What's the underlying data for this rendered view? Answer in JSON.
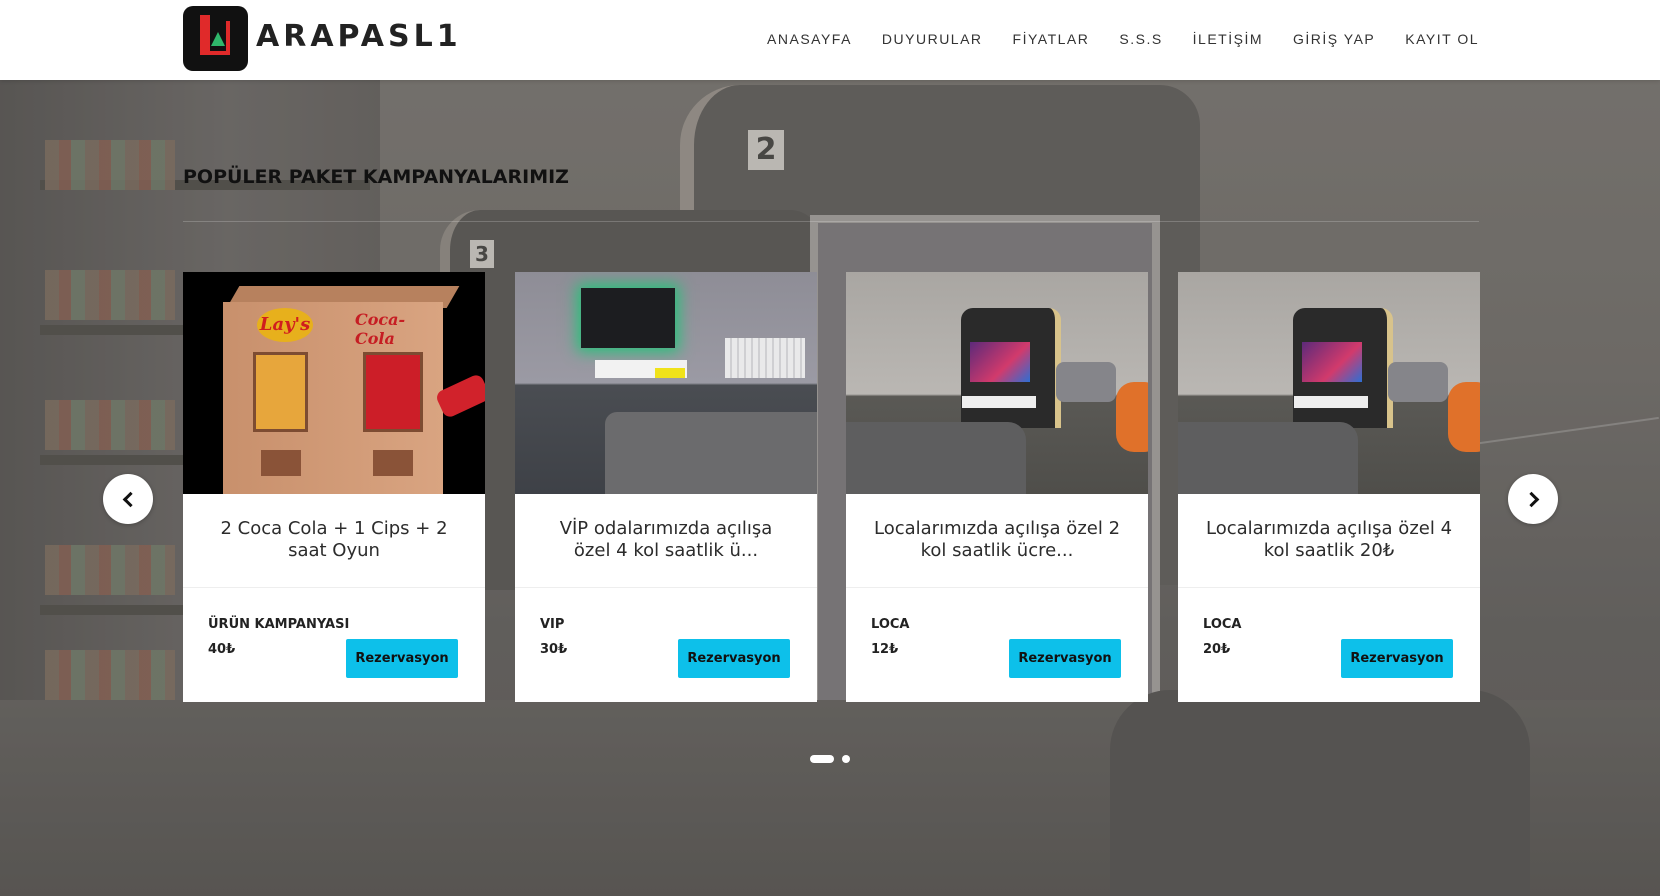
{
  "brand": {
    "name": "ARAPASL1"
  },
  "nav": {
    "items": [
      {
        "label": "ANASAYFA"
      },
      {
        "label": "DUYURULAR"
      },
      {
        "label": "FİYATLAR"
      },
      {
        "label": "S.S.S"
      },
      {
        "label": "İLETİŞİM"
      },
      {
        "label": "GİRİŞ YAP"
      },
      {
        "label": "KAYIT OL"
      }
    ]
  },
  "section": {
    "title": "POPÜLER PAKET KAMPANYALARIMIZ"
  },
  "cards": [
    {
      "title": "2 Coca Cola + 1 Cips + 2 saat Oyun",
      "category": "ÜRÜN KAMPANYASI",
      "price": "40₺",
      "button": "Rezervasyon",
      "image_icon": "vending-machine-image"
    },
    {
      "title": "VİP odalarımızda açılışa özel 4 kol saatlik ü...",
      "category": "VIP",
      "price": "30₺",
      "button": "Rezervasyon",
      "image_icon": "vip-room-image"
    },
    {
      "title": "Localarımızda açılışa özel 2 kol saatlik ücre...",
      "category": "LOCA",
      "price": "12₺",
      "button": "Rezervasyon",
      "image_icon": "loca-room-image"
    },
    {
      "title": "Localarımızda açılışa özel 4 kol saatlik 20₺",
      "category": "LOCA",
      "price": "20₺",
      "button": "Rezervasyon",
      "image_icon": "loca-room-image"
    }
  ],
  "carousel": {
    "prev_icon": "chevron-left-icon",
    "next_icon": "chevron-right-icon",
    "slides": 2,
    "active_slide": 1
  },
  "colors": {
    "button": "#0dc0ea",
    "logo_red": "#e02a2a",
    "logo_green": "#2fb86b"
  }
}
